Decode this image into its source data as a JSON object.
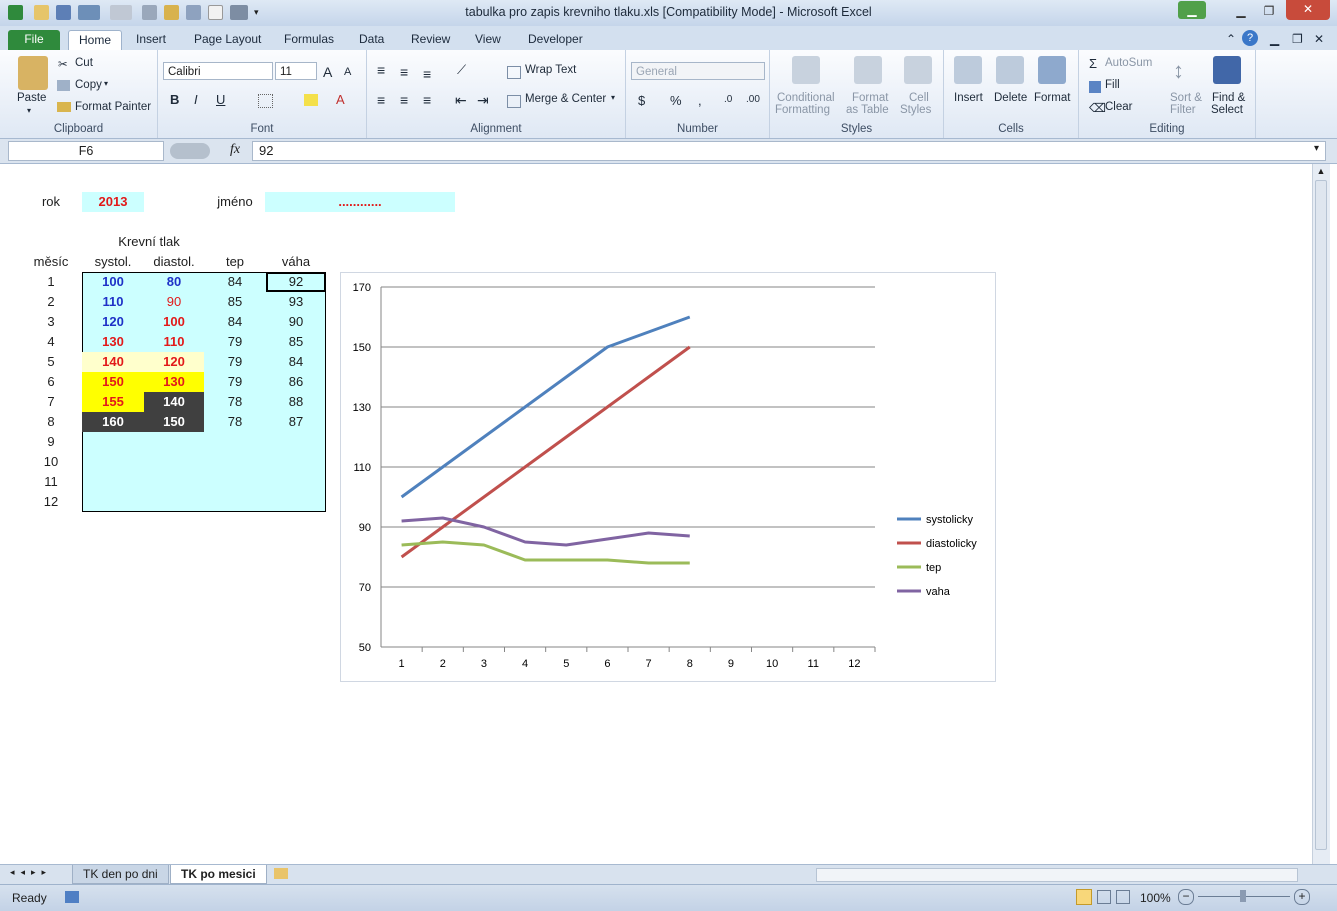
{
  "window": {
    "title": "tabulka pro zapis krevniho tlaku.xls  [Compatibility Mode]  -  Microsoft Excel"
  },
  "ribbon_tabs": [
    "File",
    "Home",
    "Insert",
    "Page Layout",
    "Formulas",
    "Data",
    "Review",
    "View",
    "Developer"
  ],
  "clipboard": {
    "paste": "Paste",
    "cut": "Cut",
    "copy": "Copy",
    "format_painter": "Format Painter",
    "label": "Clipboard"
  },
  "font": {
    "name": "Calibri",
    "size": "11",
    "bold": "B",
    "italic": "I",
    "underline": "U",
    "grow": "A",
    "label": "Font"
  },
  "alignment": {
    "wrap": "Wrap Text",
    "merge": "Merge & Center",
    "label": "Alignment"
  },
  "number": {
    "format": "General",
    "currency": "$",
    "percent": "%",
    "comma": ",",
    "label": "Number"
  },
  "styles": {
    "conditional_1": "Conditional",
    "conditional_2": "Formatting",
    "format_table_1": "Format",
    "format_table_2": "as Table",
    "cell_styles_1": "Cell",
    "cell_styles_2": "Styles",
    "label": "Styles"
  },
  "cells": {
    "insert": "Insert",
    "delete": "Delete",
    "format": "Format",
    "label": "Cells"
  },
  "editing": {
    "autosum": "AutoSum",
    "fill": "Fill",
    "clear": "Clear",
    "sort_1": "Sort &",
    "sort_2": "Filter",
    "find_1": "Find &",
    "find_2": "Select",
    "label": "Editing"
  },
  "formula_bar": {
    "name_box": "F6",
    "fx": "fx",
    "value": "92"
  },
  "sheet": {
    "rok_label": "rok",
    "rok_value": "2013",
    "jmeno_label": "jméno",
    "jmeno_value": "............",
    "header_top": "Krevní tlak",
    "headers": [
      "měsíc",
      "systol.",
      "diastol.",
      "tep",
      "váha"
    ],
    "rows": [
      {
        "m": "1",
        "s": "100",
        "d": "80",
        "t": "84",
        "v": "92"
      },
      {
        "m": "2",
        "s": "110",
        "d": "90",
        "t": "85",
        "v": "93"
      },
      {
        "m": "3",
        "s": "120",
        "d": "100",
        "t": "84",
        "v": "90"
      },
      {
        "m": "4",
        "s": "130",
        "d": "110",
        "t": "79",
        "v": "85"
      },
      {
        "m": "5",
        "s": "140",
        "d": "120",
        "t": "79",
        "v": "84"
      },
      {
        "m": "6",
        "s": "150",
        "d": "130",
        "t": "79",
        "v": "86"
      },
      {
        "m": "7",
        "s": "155",
        "d": "140",
        "t": "78",
        "v": "88"
      },
      {
        "m": "8",
        "s": "160",
        "d": "150",
        "t": "78",
        "v": "87"
      },
      {
        "m": "9",
        "s": "",
        "d": "",
        "t": "",
        "v": ""
      },
      {
        "m": "10",
        "s": "",
        "d": "",
        "t": "",
        "v": ""
      },
      {
        "m": "11",
        "s": "",
        "d": "",
        "t": "",
        "v": ""
      },
      {
        "m": "12",
        "s": "",
        "d": "",
        "t": "",
        "v": ""
      }
    ]
  },
  "chart_data": {
    "type": "line",
    "x": [
      1,
      2,
      3,
      4,
      5,
      6,
      7,
      8,
      9,
      10,
      11,
      12
    ],
    "series": [
      {
        "name": "systolicky",
        "color": "#4f81bd",
        "values": [
          100,
          110,
          120,
          130,
          140,
          150,
          155,
          160
        ]
      },
      {
        "name": "diastolicky",
        "color": "#c0504d",
        "values": [
          80,
          90,
          100,
          110,
          120,
          130,
          140,
          150
        ]
      },
      {
        "name": "tep",
        "color": "#9bbb59",
        "values": [
          84,
          85,
          84,
          79,
          79,
          79,
          78,
          78
        ]
      },
      {
        "name": "vaha",
        "color": "#8064a2",
        "values": [
          92,
          93,
          90,
          85,
          84,
          86,
          88,
          87
        ]
      }
    ],
    "ylim": [
      50,
      170
    ],
    "yticks": [
      50,
      70,
      90,
      110,
      130,
      150,
      170
    ],
    "grid": true,
    "legend_position": "right"
  },
  "sheet_tabs": [
    "TK den po dni",
    "TK po mesici"
  ],
  "status": {
    "ready": "Ready",
    "zoom": "100%"
  }
}
